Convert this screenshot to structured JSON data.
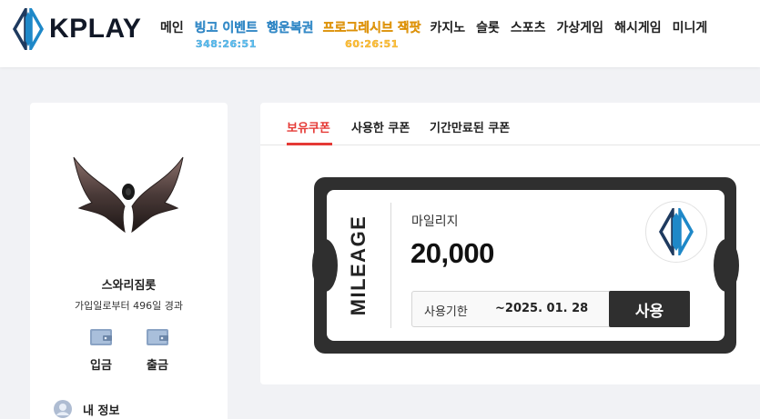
{
  "header": {
    "logo_text": "KPLAY",
    "nav": [
      {
        "label": "메인"
      },
      {
        "label": "빙고 이벤트",
        "timer": "348:26:51",
        "style": "blue"
      },
      {
        "label": "행운복권",
        "style": "blue"
      },
      {
        "label": "프로그레시브 잭팟",
        "timer": "60:26:51",
        "style": "orange"
      },
      {
        "label": "카지노"
      },
      {
        "label": "슬롯"
      },
      {
        "label": "스포츠"
      },
      {
        "label": "가상게임"
      },
      {
        "label": "해시게임"
      },
      {
        "label": "미니게"
      }
    ]
  },
  "profile": {
    "username": "스와리짐롯",
    "joined": "가입일로부터 496일 경과",
    "deposit_label": "입금",
    "withdraw_label": "출금",
    "myinfo_label": "내 정보"
  },
  "coupons": {
    "tabs": [
      {
        "label": "보유쿠폰",
        "active": true
      },
      {
        "label": "사용한 쿠폰",
        "active": false
      },
      {
        "label": "기간만료된 쿠폰",
        "active": false
      }
    ],
    "ticket": {
      "vertical_label": "MILEAGE",
      "title": "마일리지",
      "amount": "20,000",
      "expiry_label": "사용기한",
      "expiry_date": "~2025. 01. 28",
      "use_button": "사용"
    }
  },
  "colors": {
    "accent_red": "#e53935",
    "brand_blue": "#1e88c8",
    "ticket_dark": "#2f2f2f"
  }
}
